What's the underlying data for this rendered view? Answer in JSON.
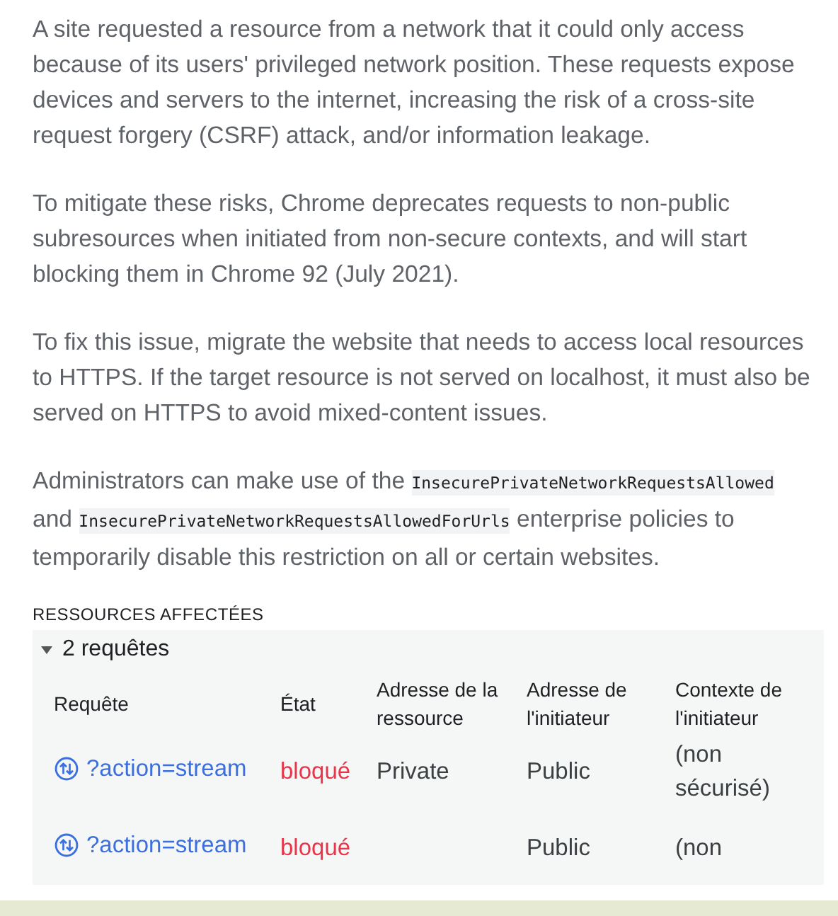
{
  "paragraphs": [
    {
      "parts": [
        {
          "text": "A site requested a resource from a network that it could only access because of its users' privileged network position. These requests expose devices and servers to the internet, increasing the risk of a cross-site request forgery (CSRF) attack, and/or information leakage."
        }
      ]
    },
    {
      "parts": [
        {
          "text": "To mitigate these risks, Chrome deprecates requests to non-public subresources when initiated from non-secure contexts, and will start blocking them in Chrome 92 (July 2021)."
        }
      ]
    },
    {
      "parts": [
        {
          "text": "To fix this issue, migrate the website that needs to access local resources to HTTPS. If the target resource is not served on localhost, it must also be served on HTTPS to avoid mixed-content issues."
        }
      ]
    },
    {
      "parts": [
        {
          "text": "Administrators can make use of the"
        },
        {
          "kind": "code",
          "text": "InsecurePrivateNetworkRequestsAllowed"
        },
        {
          "text": "and"
        },
        {
          "kind": "code",
          "text": "InsecurePrivateNetworkRequestsAllowedForUrls"
        },
        {
          "text": "enterprise policies to temporarily disable this restriction on all or certain websites."
        }
      ]
    }
  ],
  "affected": {
    "heading": "RESSOURCES AFFECTÉES",
    "group": {
      "label": "2 requêtes",
      "expanded": true
    },
    "columns": [
      "Requête",
      "État",
      "Adresse de la ressource",
      "Adresse de l'initiateur",
      "Contexte de l'initiateur"
    ],
    "rows": [
      {
        "request": "?action=stream",
        "status": "bloqué",
        "resource_address": "Private",
        "initiator_address": "Public",
        "initiator_context": "(non sécurisé)"
      },
      {
        "request": "?action=stream",
        "status": "bloqué",
        "initiator_address": "Public",
        "initiator_context": "(non"
      }
    ]
  }
}
